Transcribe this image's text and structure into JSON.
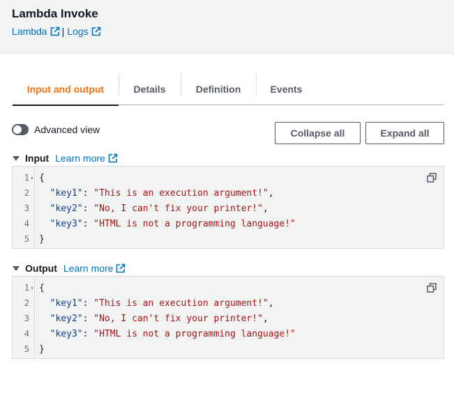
{
  "header": {
    "title": "Lambda Invoke",
    "links": [
      {
        "label": "Lambda",
        "icon": "external-link-icon"
      },
      {
        "label": "Logs",
        "icon": "external-link-icon"
      }
    ],
    "separator": "|"
  },
  "tabs": [
    {
      "label": "Input and output",
      "active": true
    },
    {
      "label": "Details",
      "active": false
    },
    {
      "label": "Definition",
      "active": false
    },
    {
      "label": "Events",
      "active": false
    }
  ],
  "controls": {
    "advanced_view_label": "Advanced view",
    "advanced_view_on": false,
    "collapse_all_label": "Collapse all",
    "expand_all_label": "Expand all"
  },
  "input": {
    "title": "Input",
    "learn_more": "Learn more",
    "lines": [
      {
        "n": "1",
        "open": "{"
      },
      {
        "n": "2",
        "key": "\"key1\"",
        "value": "\"This is an execution argument!\"",
        "trail": ","
      },
      {
        "n": "3",
        "key": "\"key2\"",
        "value": "\"No, I can't fix your printer!\"",
        "trail": ","
      },
      {
        "n": "4",
        "key": "\"key3\"",
        "value": "\"HTML is not a programming language!\"",
        "trail": ""
      },
      {
        "n": "5",
        "open": "}"
      }
    ]
  },
  "output": {
    "title": "Output",
    "learn_more": "Learn more",
    "lines": [
      {
        "n": "1",
        "open": "{"
      },
      {
        "n": "2",
        "key": "\"key1\"",
        "value": "\"This is an execution argument!\"",
        "trail": ","
      },
      {
        "n": "3",
        "key": "\"key2\"",
        "value": "\"No, I can't fix your printer!\"",
        "trail": ","
      },
      {
        "n": "4",
        "key": "\"key3\"",
        "value": "\"HTML is not a programming language!\"",
        "trail": ""
      },
      {
        "n": "5",
        "open": "}"
      }
    ]
  },
  "colors": {
    "accent_tab": "#ec7211",
    "link": "#0073bb",
    "json_key": "#0b3d91",
    "json_string": "#a31515",
    "header_bg": "#f2f3f3"
  }
}
